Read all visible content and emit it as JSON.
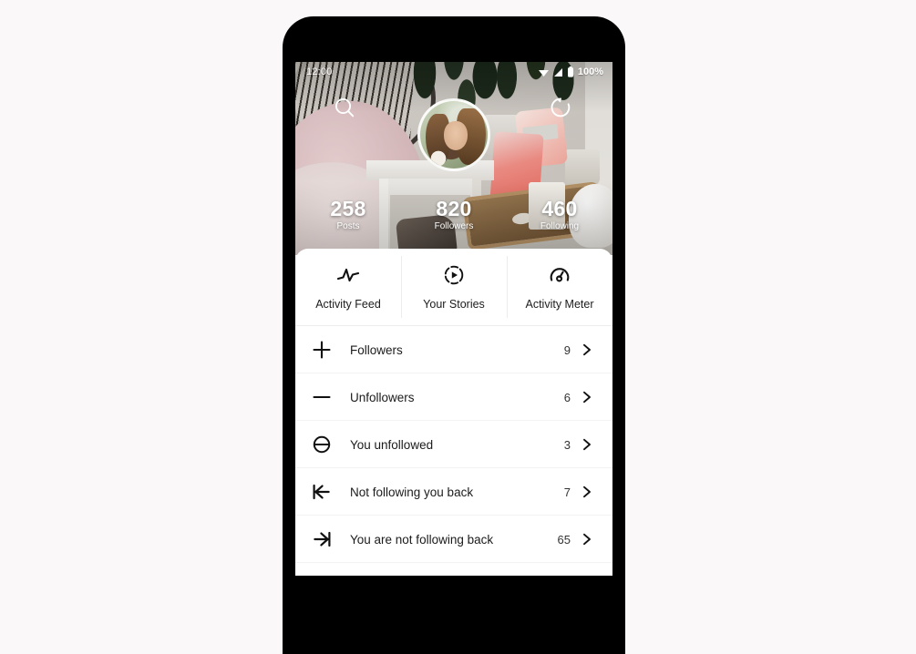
{
  "status_bar": {
    "time": "12:00",
    "battery_percent": "100%",
    "icons": [
      "wifi-icon",
      "signal-icon",
      "battery-icon"
    ]
  },
  "header": {
    "search_icon": "search-icon",
    "refresh_icon": "refresh-icon",
    "avatar": "profile-avatar",
    "stats": [
      {
        "value": "258",
        "label": "Posts"
      },
      {
        "value": "820",
        "label": "Followers"
      },
      {
        "value": "460",
        "label": "Following"
      }
    ]
  },
  "tabs": [
    {
      "label": "Activity Feed",
      "icon": "pulse-icon"
    },
    {
      "label": "Your Stories",
      "icon": "story-play-icon"
    },
    {
      "label": "Activity Meter",
      "icon": "gauge-icon"
    }
  ],
  "list": {
    "chevron_icon": "chevron-right-icon",
    "rows": [
      {
        "label": "Followers",
        "count": "9",
        "icon": "plus-icon"
      },
      {
        "label": "Unfollowers",
        "count": "6",
        "icon": "minus-icon"
      },
      {
        "label": "You unfollowed",
        "count": "3",
        "icon": "circle-minus-icon"
      },
      {
        "label": "Not following you back",
        "count": "7",
        "icon": "arrow-left-bar-icon"
      },
      {
        "label": "You are not following back",
        "count": "65",
        "icon": "arrow-right-bar-icon"
      }
    ]
  },
  "colors": {
    "canvas": "#faf8f9",
    "frame": "#000000",
    "card": "#ffffff",
    "text": "#1b1b1b",
    "divider": "#f2f2f2"
  }
}
